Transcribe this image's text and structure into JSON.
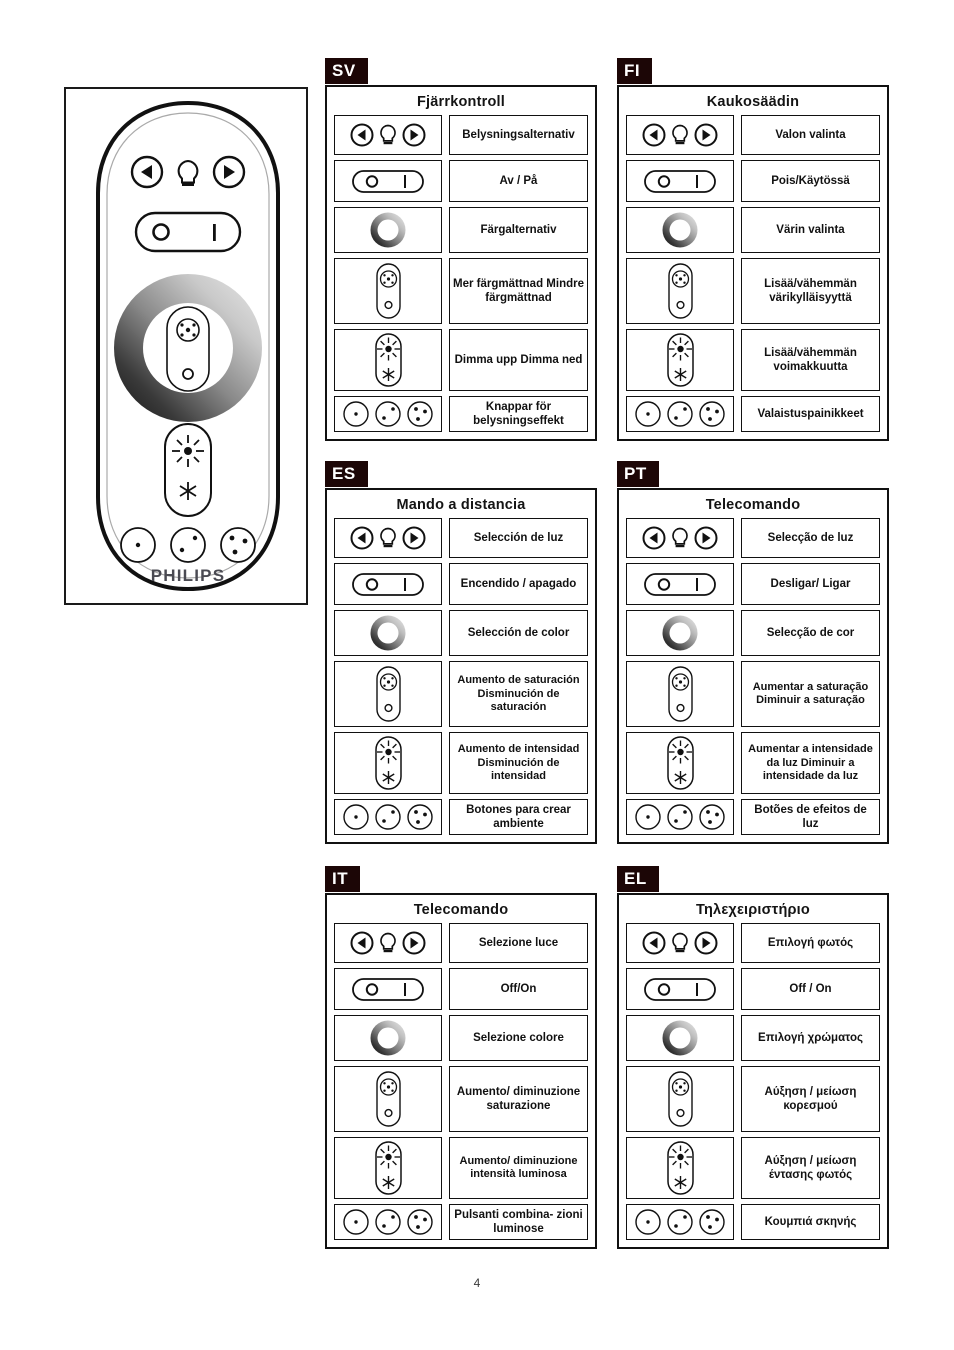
{
  "page": {
    "number": "4"
  },
  "remote": {
    "brand": "PHILIPS",
    "buttons": {
      "prev_label": "left-arrow",
      "bulb_label": "bulb",
      "next_label": "right-arrow",
      "off_label": "O",
      "on_label": "I"
    }
  },
  "icons": {
    "light_select": "light-select-icon",
    "power": "power-toggle-icon",
    "color_ring": "color-ring-icon",
    "saturation_pad": "saturation-pad-icon",
    "brightness_pad": "brightness-pad-icon",
    "scene_buttons": "scene-buttons-icon"
  },
  "panels": [
    {
      "code": "SV",
      "title": "Fjärrkontroll",
      "rows": [
        {
          "icon": "light_select",
          "text": "Belysningsalternativ"
        },
        {
          "icon": "power",
          "text": "Av / På"
        },
        {
          "icon": "color_ring",
          "text": "Färgalternativ"
        },
        {
          "icon": "saturation_pad",
          "text": "Mer färgmättnad Mindre färgmättnad"
        },
        {
          "icon": "brightness_pad",
          "text": "Dimma upp Dimma ned"
        },
        {
          "icon": "scene_buttons",
          "text": "Knappar för belysningseffekt"
        }
      ]
    },
    {
      "code": "FI",
      "title": "Kaukosäädin",
      "rows": [
        {
          "icon": "light_select",
          "text": "Valon valinta"
        },
        {
          "icon": "power",
          "text": "Pois/Käytössä"
        },
        {
          "icon": "color_ring",
          "text": "Värin valinta"
        },
        {
          "icon": "saturation_pad",
          "text": "Lisää/vähemmän värikylläisyyttä"
        },
        {
          "icon": "brightness_pad",
          "text": "Lisää/vähemmän voimakkuutta"
        },
        {
          "icon": "scene_buttons",
          "text": "Valaistuspainikkeet"
        }
      ]
    },
    {
      "code": "ES",
      "title": "Mando a distancia",
      "rows": [
        {
          "icon": "light_select",
          "text": "Selección de luz"
        },
        {
          "icon": "power",
          "text": "Encendido / apagado"
        },
        {
          "icon": "color_ring",
          "text": "Selección de color"
        },
        {
          "icon": "saturation_pad",
          "text": "Aumento de saturación Disminución de saturación"
        },
        {
          "icon": "brightness_pad",
          "text": "Aumento de intensidad Disminución de intensidad"
        },
        {
          "icon": "scene_buttons",
          "text": "Botones para crear ambiente"
        }
      ]
    },
    {
      "code": "PT",
      "title": "Telecomando",
      "rows": [
        {
          "icon": "light_select",
          "text": "Selecção de luz"
        },
        {
          "icon": "power",
          "text": "Desligar/ Ligar"
        },
        {
          "icon": "color_ring",
          "text": "Selecção de cor"
        },
        {
          "icon": "saturation_pad",
          "text": "Aumentar a saturação Diminuir a saturação"
        },
        {
          "icon": "brightness_pad",
          "text": "Aumentar a intensidade da luz Diminuir a intensidade da luz"
        },
        {
          "icon": "scene_buttons",
          "text": "Botões de efeitos de luz"
        }
      ]
    },
    {
      "code": "IT",
      "title": "Telecomando",
      "rows": [
        {
          "icon": "light_select",
          "text": "Selezione luce"
        },
        {
          "icon": "power",
          "text": "Off/On"
        },
        {
          "icon": "color_ring",
          "text": "Selezione colore"
        },
        {
          "icon": "saturation_pad",
          "text": "Aumento/ diminuzione saturazione"
        },
        {
          "icon": "brightness_pad",
          "text": "Aumento/ diminuzione intensità luminosa"
        },
        {
          "icon": "scene_buttons",
          "text": "Pulsanti combina- zioni luminose"
        }
      ]
    },
    {
      "code": "EL",
      "title": "Τηλεχειριστήριο",
      "rows": [
        {
          "icon": "light_select",
          "text": "Επιλογή φωτός"
        },
        {
          "icon": "power",
          "text": "Off / On"
        },
        {
          "icon": "color_ring",
          "text": "Επιλογή χρώματος"
        },
        {
          "icon": "saturation_pad",
          "text": "Αύξηση / μείωση κορεσμού"
        },
        {
          "icon": "brightness_pad",
          "text": "Αύξηση / μείωση έντασης φωτός"
        },
        {
          "icon": "scene_buttons",
          "text": "Κουμπιά σκηνής"
        }
      ]
    }
  ],
  "colors": {
    "tag_bg": "#1c0606",
    "tag_fg": "#ffffff",
    "border": "#111111",
    "brand_gray": "#4a4a52"
  }
}
